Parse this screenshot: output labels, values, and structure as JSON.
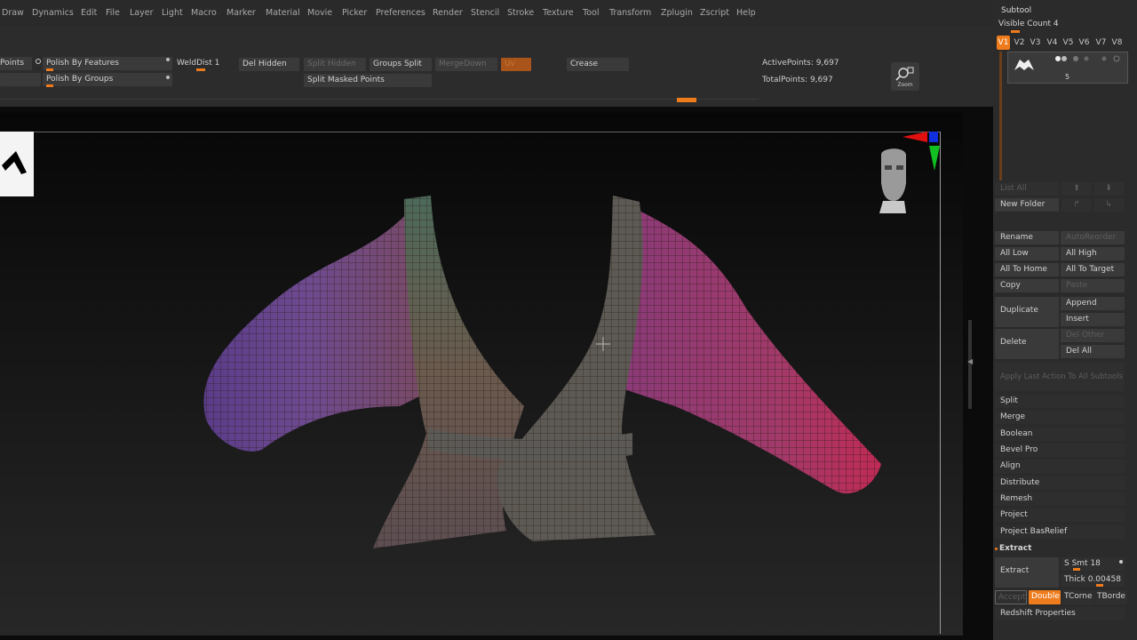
{
  "menu": {
    "items": [
      "Draw",
      "Dynamics",
      "Edit",
      "File",
      "Layer",
      "Light",
      "Macro",
      "Marker",
      "Material",
      "Movie",
      "Picker",
      "Preferences",
      "Render",
      "Stencil",
      "Stroke",
      "Texture",
      "Tool",
      "Transform",
      "Zplugin",
      "Zscript",
      "Help"
    ]
  },
  "shelf": {
    "points_label": "Points",
    "polish_features": "Polish By Features",
    "polish_groups": "Polish By Groups",
    "weld_dist": "WeldDist 1",
    "del_hidden": "Del Hidden",
    "split_hidden": "Split Hidden",
    "groups_split": "Groups Split",
    "merge_down": "MergeDown",
    "uv": "Uv",
    "crease": "Crease",
    "split_masked": "Split Masked Points",
    "active_points": "ActivePoints: 9,697",
    "total_points": "TotalPoints: 9,697",
    "zoom": "Zoom"
  },
  "subtool": {
    "title": "Subtool",
    "visible_count": "Visible Count 4",
    "versions": [
      "V1",
      "V2",
      "V3",
      "V4",
      "V5",
      "V6",
      "V7",
      "V8"
    ],
    "item_number": "5",
    "list_all": "List All",
    "new_folder": "New Folder",
    "rename": "Rename",
    "auto_reorder": "AutoReorder",
    "all_low": "All Low",
    "all_high": "All High",
    "all_to_home": "All To Home",
    "all_to_target": "All To Target",
    "copy": "Copy",
    "paste": "Paste",
    "duplicate": "Duplicate",
    "append": "Append",
    "insert": "Insert",
    "delete": "Delete",
    "del_other": "Del Other",
    "del_all": "Del All",
    "apply_last": "Apply Last Action To All Subtools",
    "split": "Split",
    "merge": "Merge",
    "boolean": "Boolean",
    "bevel_pro": "Bevel Pro",
    "align": "Align",
    "distribute": "Distribute",
    "remesh": "Remesh",
    "project": "Project",
    "project_basrelief": "Project BasRelief",
    "extract_header": "Extract",
    "extract_button": "Extract",
    "s_smt": "S Smt 18",
    "thick": "Thick 0.00458",
    "accept": "Accept",
    "double": "Double",
    "tcorne": "TCorne",
    "tborde": "TBorde",
    "redshift": "Redshift Properties"
  },
  "colors": {
    "accent": "#ee7b1c",
    "panel": "#2b2b2b",
    "button": "#3a3a3a"
  }
}
